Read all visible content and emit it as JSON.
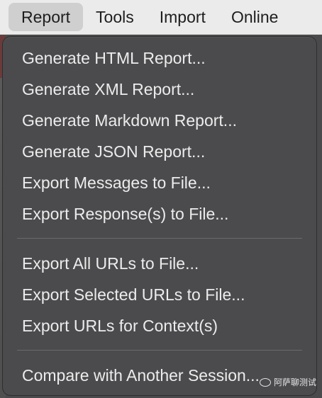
{
  "menubar": {
    "items": [
      {
        "label": "Report",
        "active": true
      },
      {
        "label": "Tools"
      },
      {
        "label": "Import"
      },
      {
        "label": "Online"
      }
    ]
  },
  "dropdown": {
    "group1": [
      "Generate HTML Report...",
      "Generate XML Report...",
      "Generate Markdown Report...",
      "Generate JSON Report...",
      "Export Messages to File...",
      "Export Response(s) to File..."
    ],
    "group2": [
      "Export All URLs to File...",
      "Export Selected URLs to File...",
      "Export URLs for Context(s)"
    ],
    "group3": [
      "Compare with Another Session..."
    ]
  },
  "watermark": {
    "text": "阿萨聊测试",
    "icon": "wechat-icon"
  },
  "colors": {
    "menubar_bg": "#ebebeb",
    "active_menu_bg": "#cfcfcf",
    "dropdown_bg": "#4b4b4e",
    "menu_text": "#ececec"
  }
}
